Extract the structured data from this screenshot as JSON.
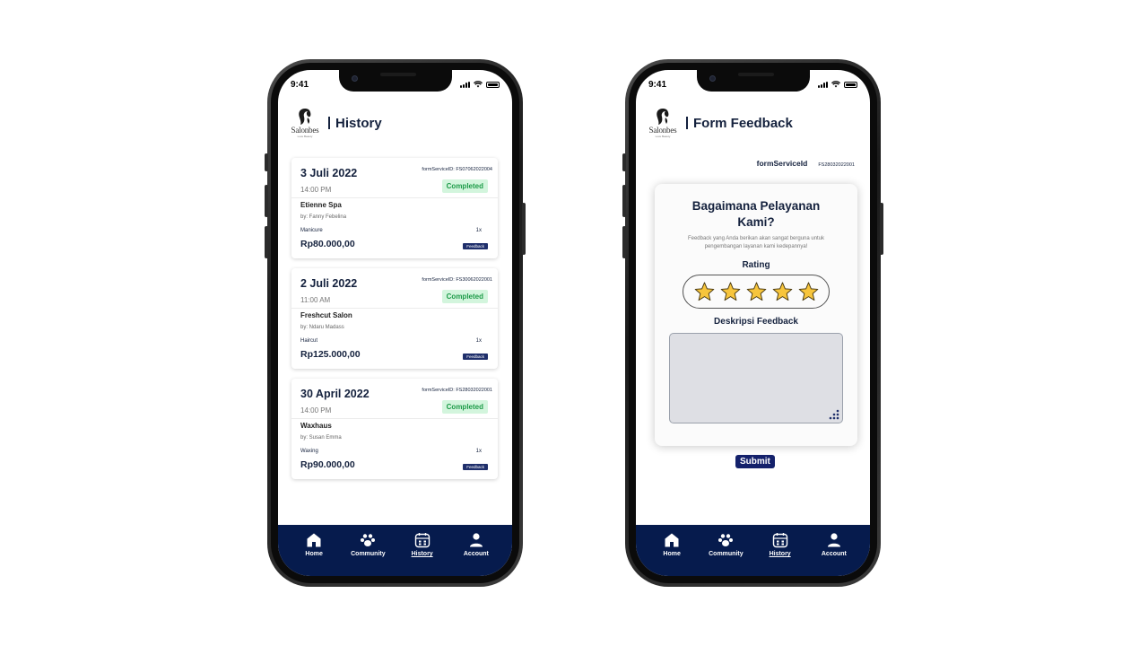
{
  "colors": {
    "navy": "#14213d",
    "nav_bg": "#061b4d",
    "completed_bg": "#d3f5dd",
    "completed_text": "#1d9b48",
    "star": "#f7c53c"
  },
  "status_bar": {
    "time": "9:41"
  },
  "logo": {
    "text": "Salonbes",
    "sub": "Love Beauty"
  },
  "history_screen": {
    "title": "History",
    "orders": [
      {
        "date": "3 Juli 2022",
        "form_id": "formServiceID: FS07062022004",
        "time": "14:00 PM",
        "status": "Completed",
        "salon": "Etienne Spa",
        "by": "by: Fanny Febelina",
        "service": "Manicure",
        "qty": "1x",
        "price": "Rp80.000,00",
        "feedback_label": "Feedback"
      },
      {
        "date": "2 Juli 2022",
        "form_id": "formServiceID: FS30062022001",
        "time": "11:00 AM",
        "status": "Completed",
        "salon": "Freshcut Salon",
        "by": "by: Ndaru Madass",
        "service": "Haircut",
        "qty": "1x",
        "price": "Rp125.000,00",
        "feedback_label": "Feedback"
      },
      {
        "date": "30 April 2022",
        "form_id": "formServiceID: FS28032022001",
        "time": "14:00 PM",
        "status": "Completed",
        "salon": "Waxhaus",
        "by": "by: Susan Emma",
        "service": "Waxing",
        "qty": "1x",
        "price": "Rp90.000,00",
        "feedback_label": "Feedback"
      }
    ]
  },
  "feedback_screen": {
    "title": "Form Feedback",
    "form_service_label": "formServiceId",
    "form_service_value": "FS28032022001",
    "question": "Bagaimana Pelayanan Kami?",
    "subtitle": "Feedback yang Anda berikan akan sangat berguna untuk pengembangan layanan kami kedepannya!",
    "rating_label": "Rating",
    "rating": 5,
    "rating_max": 5,
    "description_label": "Deskripsi Feedback",
    "description_value": "",
    "submit_label": "Submit"
  },
  "nav": {
    "items": [
      {
        "label": "Home",
        "icon": "home-icon"
      },
      {
        "label": "Community",
        "icon": "community-icon"
      },
      {
        "label": "History",
        "icon": "history-icon"
      },
      {
        "label": "Account",
        "icon": "account-icon"
      }
    ],
    "active": "History"
  }
}
